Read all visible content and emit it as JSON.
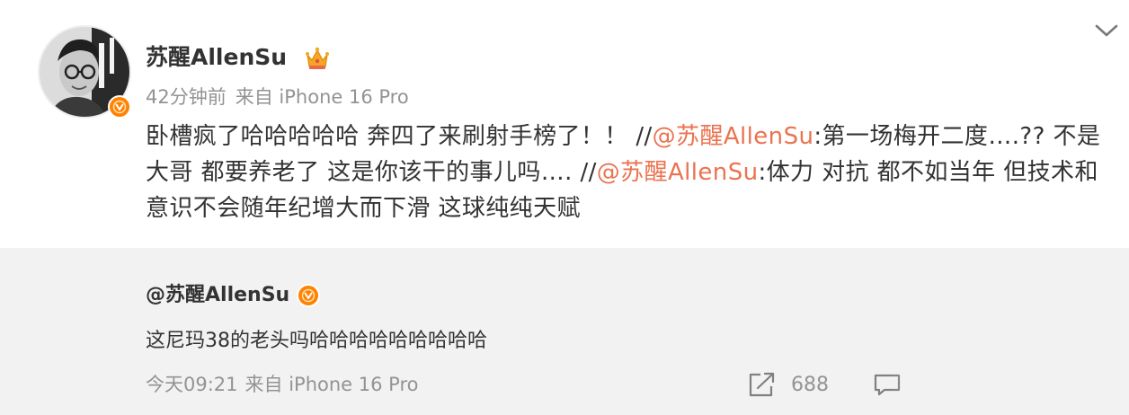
{
  "post": {
    "author": "苏醒AllenSu",
    "time": "42分钟前",
    "source": "来自 iPhone 16 Pro",
    "text_parts": {
      "p1": "卧槽疯了哈哈哈哈哈 奔四了来刷射手榜了！！ //",
      "m1": "@苏醒AllenSu",
      "p2": ":第一场梅开二度….?? 不是 大哥 都要养老了 这是你该干的事儿吗…. //",
      "m2": "@苏醒AllenSu",
      "p3": ":体力 对抗 都不如当年 但技术和意识不会随年纪增大而下滑 这球纯纯天赋"
    }
  },
  "repost": {
    "author": "@苏醒AllenSu",
    "text": "这尼玛38的老头吗哈哈哈哈哈哈哈哈哈",
    "time": "今天09:21",
    "source": "来自 iPhone 16 Pro",
    "share_count": "688"
  },
  "colors": {
    "mention": "#eb7350",
    "verify_badge": "#ff8200",
    "meta_gray": "#939393",
    "repost_bg": "#f2f2f2"
  },
  "icons": [
    "avatar",
    "verified-badge-icon",
    "vip-crown-icon",
    "chevron-down-icon",
    "share-icon",
    "comment-icon"
  ]
}
